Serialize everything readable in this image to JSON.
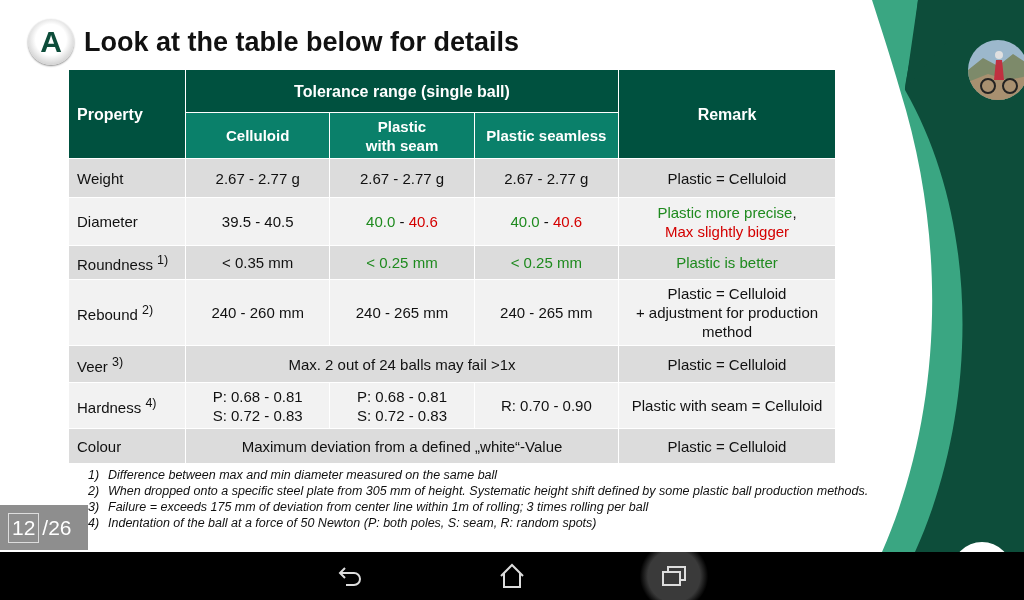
{
  "slide": {
    "badge": "A",
    "title": "Look at the table below for details",
    "table": {
      "property": "Property",
      "group": "Tolerance range (single ball)",
      "columns": [
        "Celluloid",
        "Plastic\nwith seam",
        "Plastic seamless"
      ],
      "remark": "Remark",
      "rows": [
        {
          "label": "Weight",
          "values": [
            [
              [
                {
                  "text": "2.67 - 2.77 g"
                }
              ]
            ],
            [
              [
                {
                  "text": "2.67 - 2.77 g"
                }
              ]
            ],
            [
              [
                {
                  "text": "2.67 - 2.77 g"
                }
              ]
            ]
          ],
          "remark": [
            [
              {
                "text": "Plastic = Celluloid"
              }
            ]
          ]
        },
        {
          "label": "Diameter",
          "values": [
            [
              [
                {
                  "text": "39.5 - 40.5"
                }
              ]
            ],
            [
              [
                {
                  "text": "40.0",
                  "color": "#1e8a1e"
                },
                {
                  "text": " - "
                },
                {
                  "text": "40.6",
                  "color": "#d40000"
                }
              ]
            ],
            [
              [
                {
                  "text": "40.0",
                  "color": "#1e8a1e"
                },
                {
                  "text": " - "
                },
                {
                  "text": "40.6",
                  "color": "#d40000"
                }
              ]
            ]
          ],
          "remark": [
            [
              {
                "text": "Plastic more precise",
                "color": "#1e8a1e"
              },
              {
                "text": ","
              }
            ],
            [
              {
                "text": "Max slightly bigger",
                "color": "#d40000"
              }
            ]
          ]
        },
        {
          "label": "Roundness $^{1)}$",
          "values": [
            [
              [
                {
                  "text": "< 0.35 mm"
                }
              ]
            ],
            [
              [
                {
                  "text": "< 0.25 mm",
                  "color": "#1e8a1e"
                }
              ]
            ],
            [
              [
                {
                  "text": "< 0.25 mm",
                  "color": "#1e8a1e"
                }
              ]
            ]
          ],
          "remark": [
            [
              {
                "text": "Plastic is better",
                "color": "#1e8a1e"
              }
            ]
          ]
        },
        {
          "label": "Rebound $^{2)}$",
          "values": [
            [
              [
                {
                  "text": "240 - 260 mm"
                }
              ]
            ],
            [
              [
                {
                  "text": "240 - 265 mm"
                }
              ]
            ],
            [
              [
                {
                  "text": "240 - 265 mm"
                }
              ]
            ]
          ],
          "remark": [
            [
              {
                "text": "Plastic = Celluloid"
              }
            ],
            [
              {
                "text": "+  adjustment for production"
              }
            ],
            [
              {
                "text": "method"
              }
            ]
          ]
        },
        {
          "label": "Veer $^{3)}$",
          "shared": [
            [
              {
                "text": "Max. 2 out of 24 balls may  fail >1x"
              }
            ]
          ],
          "remark": [
            [
              {
                "text": "Plastic = Celluloid"
              }
            ]
          ]
        },
        {
          "label": "Hardness $^{4)}$",
          "values": [
            [
              [
                {
                  "text": "P: 0.68 - 0.81"
                }
              ],
              [
                {
                  "text": "S: 0.72 - 0.83"
                }
              ]
            ],
            [
              [
                {
                  "text": "P: 0.68 - 0.81"
                }
              ],
              [
                {
                  "text": "S: 0.72 - 0.83"
                }
              ]
            ],
            [
              [
                {
                  "text": "R: 0.70 - 0.90"
                }
              ]
            ]
          ],
          "remark": [
            [
              {
                "text": "Plastic with seam = Celluloid"
              }
            ]
          ]
        },
        {
          "label": "Colour",
          "shared": [
            [
              {
                "text": "Maximum deviation from a defined „white“-Value"
              }
            ]
          ],
          "remark": [
            [
              {
                "text": "Plastic = Celluloid"
              }
            ]
          ]
        }
      ]
    },
    "footnotes": [
      {
        "mark": "1)",
        "text": "Difference between max and min diameter measured on the same ball"
      },
      {
        "mark": "2)",
        "text": "When dropped onto a specific steel plate from 305 mm of height. Systematic height shift defined by some plastic ball production methods."
      },
      {
        "mark": "3)",
        "text": "Failure = exceeds 175 mm of deviation from center line within 1m of rolling; 3 times rolling per ball"
      },
      {
        "mark": "4)",
        "text": "Indentation of the ball at a force of 50 Newton  (P: both poles, S: seam, R: random spots)"
      }
    ]
  },
  "page_counter": {
    "current": "12",
    "total": "/26"
  },
  "nav_bar": [
    {
      "kind": "back",
      "pressed": false
    },
    {
      "kind": "home",
      "pressed": false
    },
    {
      "kind": "recents",
      "pressed": true
    }
  ]
}
